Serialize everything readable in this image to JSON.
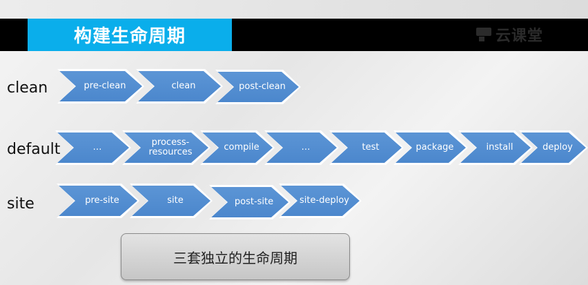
{
  "header": {
    "title": "构建生命周期",
    "logo_text": "云课堂"
  },
  "rows": [
    {
      "label": "clean",
      "phases": [
        "pre-clean",
        "clean",
        "post-clean"
      ]
    },
    {
      "label": "default",
      "phases": [
        "…",
        "process-\nresources",
        "compile",
        "…",
        "test",
        "package",
        "install",
        "deploy"
      ]
    },
    {
      "label": "site",
      "phases": [
        "pre-site",
        "site",
        "post-site",
        "site-deploy"
      ]
    }
  ],
  "summary": {
    "text": "三套独立的生命周期"
  },
  "colors": {
    "header_bg": "#000000",
    "title_bg": "#0aaeeb",
    "chevron_fill": "#4a86cc",
    "chevron_border": "#ffffff"
  }
}
